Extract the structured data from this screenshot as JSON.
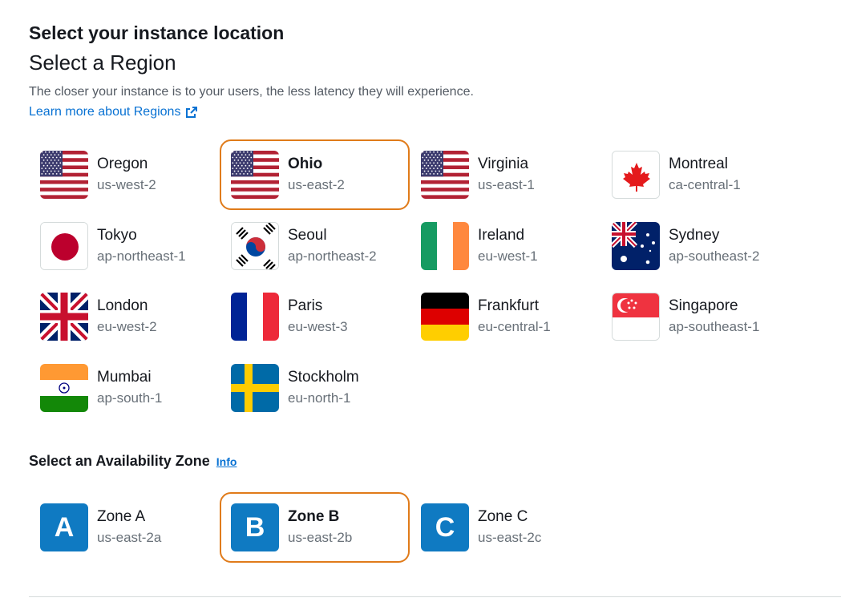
{
  "header": {
    "title": "Select your instance location",
    "region_heading": "Select a Region",
    "description": "The closer your instance is to your users, the less latency they will experience.",
    "learn_more": "Learn more about Regions"
  },
  "regions": [
    {
      "name": "Oregon",
      "code": "us-west-2",
      "flag": "us-flag-icon",
      "selected": false
    },
    {
      "name": "Ohio",
      "code": "us-east-2",
      "flag": "us-flag-icon",
      "selected": true
    },
    {
      "name": "Virginia",
      "code": "us-east-1",
      "flag": "us-flag-icon",
      "selected": false
    },
    {
      "name": "Montreal",
      "code": "ca-central-1",
      "flag": "canada-flag-icon",
      "selected": false
    },
    {
      "name": "Tokyo",
      "code": "ap-northeast-1",
      "flag": "japan-flag-icon",
      "selected": false
    },
    {
      "name": "Seoul",
      "code": "ap-northeast-2",
      "flag": "korea-flag-icon",
      "selected": false
    },
    {
      "name": "Ireland",
      "code": "eu-west-1",
      "flag": "ireland-flag-icon",
      "selected": false
    },
    {
      "name": "Sydney",
      "code": "ap-southeast-2",
      "flag": "australia-flag-icon",
      "selected": false
    },
    {
      "name": "London",
      "code": "eu-west-2",
      "flag": "uk-flag-icon",
      "selected": false
    },
    {
      "name": "Paris",
      "code": "eu-west-3",
      "flag": "france-flag-icon",
      "selected": false
    },
    {
      "name": "Frankfurt",
      "code": "eu-central-1",
      "flag": "germany-flag-icon",
      "selected": false
    },
    {
      "name": "Singapore",
      "code": "ap-southeast-1",
      "flag": "singapore-flag-icon",
      "selected": false
    },
    {
      "name": "Mumbai",
      "code": "ap-south-1",
      "flag": "india-flag-icon",
      "selected": false
    },
    {
      "name": "Stockholm",
      "code": "eu-north-1",
      "flag": "sweden-flag-icon",
      "selected": false
    }
  ],
  "availability": {
    "title": "Select an Availability Zone",
    "info": "Info",
    "zones": [
      {
        "letter": "A",
        "name": "Zone A",
        "code": "us-east-2a",
        "selected": false
      },
      {
        "letter": "B",
        "name": "Zone B",
        "code": "us-east-2b",
        "selected": true
      },
      {
        "letter": "C",
        "name": "Zone C",
        "code": "us-east-2c",
        "selected": false
      }
    ]
  },
  "colors": {
    "selected_border": "#e07b1a",
    "link": "#0972d3",
    "zone_tile": "#0f7ac2"
  }
}
